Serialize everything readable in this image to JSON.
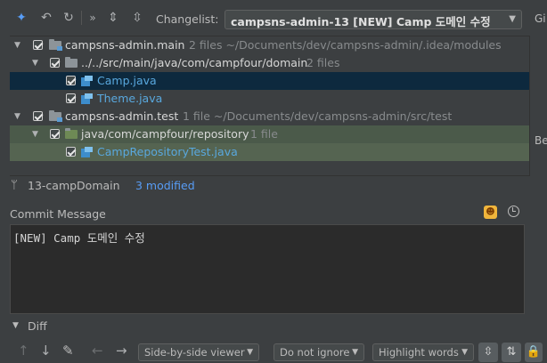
{
  "toolbar": {
    "changelist_label": "Changelist:",
    "changelist_value": "campsns-admin-13 [NEW] Camp 도메인 수정",
    "overflow": "»"
  },
  "side_cut": {
    "top": "Gi",
    "middle": "Be"
  },
  "tree": {
    "rows": [
      {
        "name": "campsns-admin.main",
        "meta": "2 files  ~/Documents/dev/campsns-admin/.idea/modules"
      },
      {
        "name": "../../src/main/java/com/campfour/domain",
        "meta": "2 files"
      },
      {
        "name": "Camp.java",
        "meta": ""
      },
      {
        "name": "Theme.java",
        "meta": ""
      },
      {
        "name": "campsns-admin.test",
        "meta": "1 file  ~/Documents/dev/campsns-admin/src/test"
      },
      {
        "name": "java/com/campfour/repository",
        "meta": "1 file"
      },
      {
        "name": "CampRepositoryTest.java",
        "meta": ""
      }
    ]
  },
  "status": {
    "branch": "13-campDomain",
    "modified": "3 modified"
  },
  "commit": {
    "label": "Commit Message",
    "text": "[NEW] Camp 도메인 수정"
  },
  "diff": {
    "label": "Diff",
    "viewer": "Side-by-side viewer",
    "ignore": "Do not ignore",
    "highlight": "Highlight words"
  }
}
